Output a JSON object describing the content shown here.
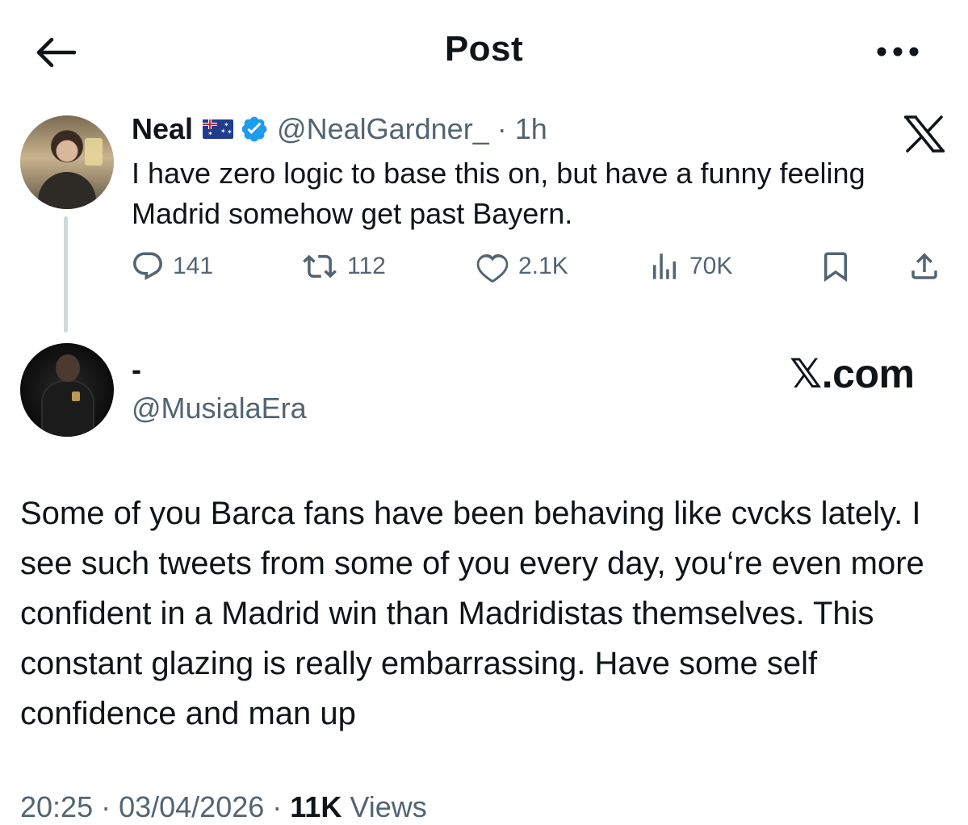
{
  "header": {
    "title": "Post"
  },
  "parent_tweet": {
    "display_name": "Neal",
    "handle": "@NealGardner_",
    "time": "· 1h",
    "text": "I have zero logic to base this on, but have a funny feeling Madrid somehow get past Bayern.",
    "stats": {
      "replies": "141",
      "reposts": "112",
      "likes": "2.1K",
      "views": "70K"
    }
  },
  "reply_tweet": {
    "display_name": "-",
    "handle": "@MusialaEra",
    "text": "Some of you Barca fans have been behaving like cvcks lately. I see such tweets from some of you every day, you‘re even more confident in a Madrid win than Madridistas themselves. This constant glazing is really embarrassing. Have some self confidence and man up",
    "timestamp": "20:25 · 03/04/2026 ·",
    "views_count": "11K",
    "views_label": "Views"
  },
  "watermark": {
    "text": "𝕏.com"
  },
  "icons": {
    "back": "arrow-left-icon",
    "more": "more-dots-icon",
    "verified": "verified-badge-icon",
    "flag": "australia-flag-icon",
    "brand": "x-logo-icon",
    "reply": "reply-icon",
    "repost": "repost-icon",
    "like": "heart-icon",
    "views": "views-bars-icon",
    "bookmark": "bookmark-icon",
    "share": "share-icon"
  },
  "colors": {
    "text": "#0f1419",
    "secondary": "#536471",
    "verified": "#1d9bf0",
    "thread_line": "#cfd9de"
  }
}
